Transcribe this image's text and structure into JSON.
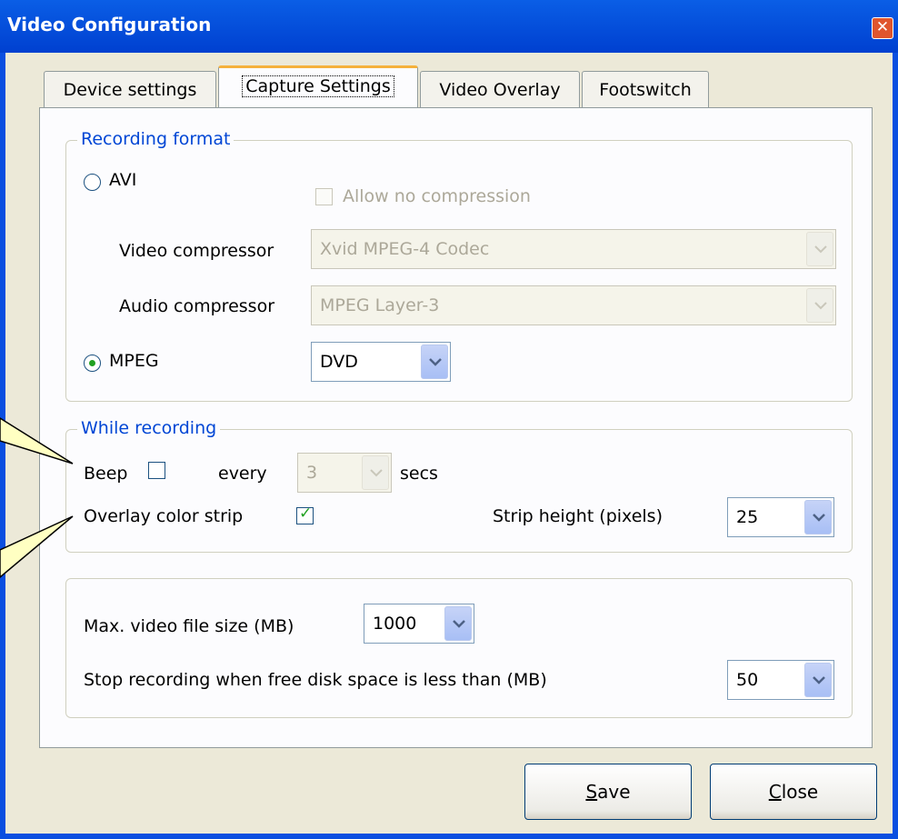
{
  "window": {
    "title": "Video Configuration"
  },
  "tabs": [
    {
      "label": "Device settings"
    },
    {
      "label": "Capture Settings"
    },
    {
      "label": "Video Overlay"
    },
    {
      "label": "Footswitch"
    }
  ],
  "recording_format": {
    "legend": "Recording format",
    "avi_label": "AVI",
    "allow_no_compression": "Allow no compression",
    "video_compressor_label": "Video compressor",
    "video_compressor_value": "Xvid MPEG-4 Codec",
    "audio_compressor_label": "Audio compressor",
    "audio_compressor_value": "MPEG Layer-3",
    "mpeg_label": "MPEG",
    "mpeg_value": "DVD"
  },
  "while_recording": {
    "legend": "While recording",
    "beep_label": "Beep",
    "every_label": "every",
    "interval_value": "3",
    "secs_label": "secs",
    "overlay_label": "Overlay color strip",
    "strip_height_label": "Strip height (pixels)",
    "strip_height_value": "25"
  },
  "limits": {
    "max_size_label": "Max. video file size (MB)",
    "max_size_value": "1000",
    "stop_label": "Stop recording when free disk space is less than (MB)",
    "stop_value": "50"
  },
  "buttons": {
    "save_mnemonic": "S",
    "save_rest": "ave",
    "close_mnemonic": "C",
    "close_rest": "lose"
  },
  "icons": {
    "close": "close-icon",
    "dropdown": "chevron-down-icon",
    "check": "check-icon"
  }
}
